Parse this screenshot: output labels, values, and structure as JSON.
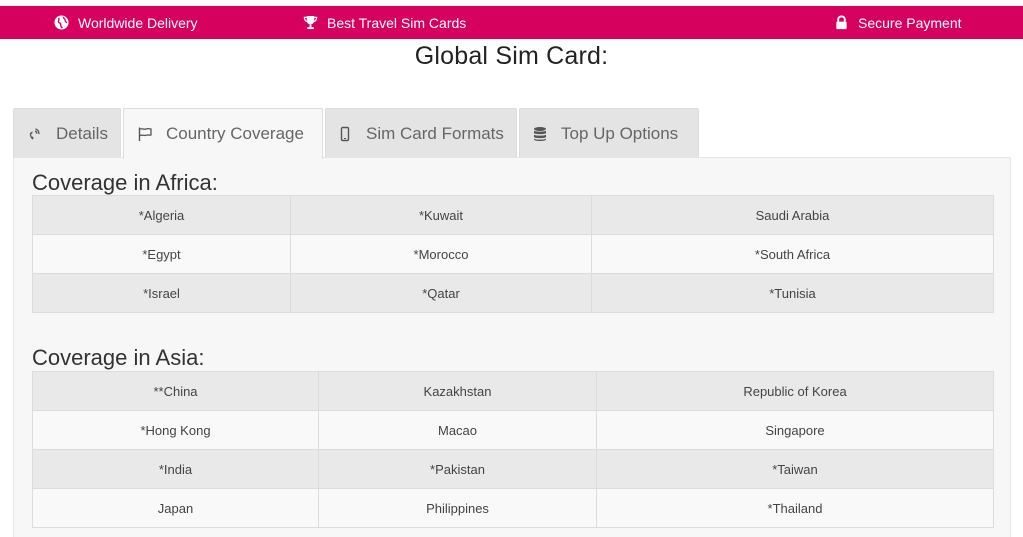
{
  "topbar": {
    "items": [
      {
        "label": "Worldwide Delivery",
        "icon": "globe-icon"
      },
      {
        "label": "Best Travel Sim Cards",
        "icon": "trophy-icon"
      },
      {
        "label": "Secure Payment",
        "icon": "lock-icon"
      }
    ],
    "color": "#d6005e"
  },
  "page": {
    "title": "Global Sim Card:"
  },
  "tabs": [
    {
      "label": "Details",
      "icon": "phone-signal-icon"
    },
    {
      "label": "Country Coverage",
      "icon": "flag-icon",
      "active": true
    },
    {
      "label": "Sim Card Formats",
      "icon": "mobile-icon"
    },
    {
      "label": "Top Up Options",
      "icon": "database-icon"
    }
  ],
  "coverage": {
    "africa": {
      "heading": "Coverage in Africa:",
      "rows": [
        [
          "*Algeria",
          "*Kuwait",
          "Saudi Arabia"
        ],
        [
          "*Egypt",
          "*Morocco",
          "*South Africa"
        ],
        [
          "*Israel",
          "*Qatar",
          "*Tunisia"
        ]
      ]
    },
    "asia": {
      "heading": "Coverage in Asia:",
      "rows": [
        [
          "**China",
          "Kazakhstan",
          "Republic of Korea"
        ],
        [
          "*Hong Kong",
          "Macao",
          "Singapore"
        ],
        [
          "*India",
          "*Pakistan",
          "*Taiwan"
        ],
        [
          "Japan",
          "Philippines",
          "*Thailand"
        ]
      ]
    }
  }
}
